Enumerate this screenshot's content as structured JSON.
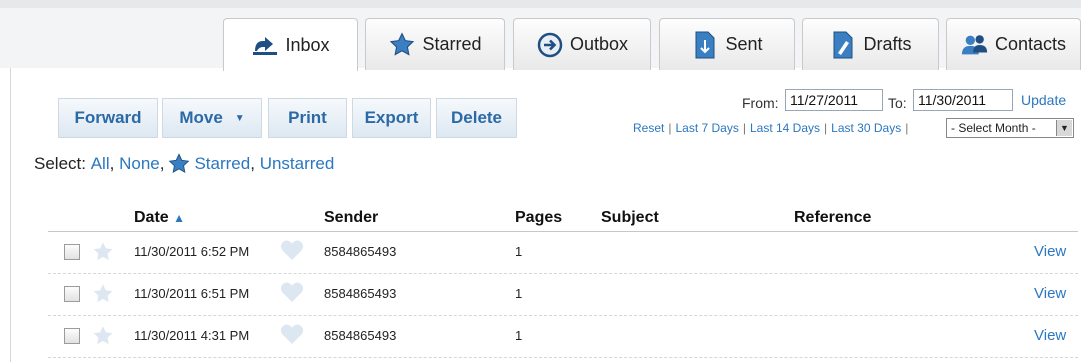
{
  "tabs": [
    {
      "label": "Inbox",
      "icon": "fax-inbox-icon",
      "active": true
    },
    {
      "label": "Starred",
      "icon": "star-icon",
      "active": false
    },
    {
      "label": "Outbox",
      "icon": "arrow-right-circle-icon",
      "active": false
    },
    {
      "label": "Sent",
      "icon": "sent-document-icon",
      "active": false
    },
    {
      "label": "Drafts",
      "icon": "drafts-document-icon",
      "active": false
    },
    {
      "label": "Contacts",
      "icon": "people-icon",
      "active": false
    }
  ],
  "toolbar": {
    "forward": "Forward",
    "move": "Move",
    "print": "Print",
    "export": "Export",
    "delete": "Delete"
  },
  "date_filter": {
    "from_label": "From:",
    "from_value": "11/27/2011",
    "to_label": "To:",
    "to_value": "11/30/2011",
    "update": "Update",
    "reset": "Reset",
    "last7": "Last 7 Days",
    "last14": "Last 14 Days",
    "last30": "Last 30 Days",
    "separator": "|",
    "month_select": "- Select Month -"
  },
  "select": {
    "label": "Select:",
    "all": "All",
    "none": "None",
    "starred": "Starred",
    "unstarred": "Unstarred",
    "comma": ","
  },
  "table": {
    "headers": {
      "date": "Date",
      "sort_indicator": "▲",
      "sender": "Sender",
      "pages": "Pages",
      "subject": "Subject",
      "reference": "Reference"
    },
    "rows": [
      {
        "date": "11/30/2011 6:52 PM",
        "sender": "8584865493",
        "pages": "1",
        "subject": "",
        "reference": "",
        "action": "View"
      },
      {
        "date": "11/30/2011 6:51 PM",
        "sender": "8584865493",
        "pages": "1",
        "subject": "",
        "reference": "",
        "action": "View"
      },
      {
        "date": "11/30/2011 4:31 PM",
        "sender": "8584865493",
        "pages": "1",
        "subject": "",
        "reference": "",
        "action": "View"
      }
    ]
  },
  "colors": {
    "link": "#2b77c0",
    "button_text": "#2b6aa7",
    "star_blue": "#3a7fc2",
    "star_faded": "#dce7f1"
  }
}
